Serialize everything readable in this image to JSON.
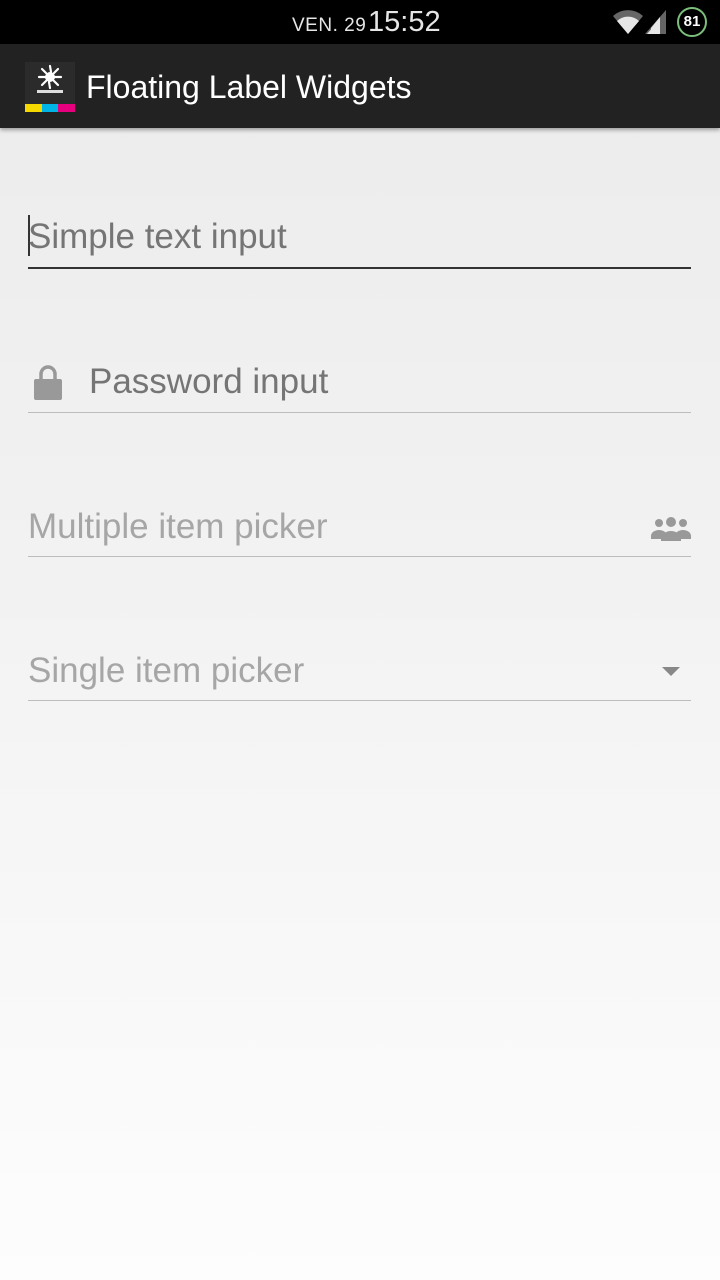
{
  "status_bar": {
    "date": "VEN. 29",
    "time": "15:52",
    "battery": "81",
    "icons": [
      "wifi-icon",
      "signal-icon",
      "battery-icon"
    ]
  },
  "action_bar": {
    "title": "Floating Label Widgets",
    "logo_icon": "app-logo-icon"
  },
  "form": {
    "simple_text": {
      "placeholder": "Simple text input",
      "value": ""
    },
    "password": {
      "placeholder": "Password input",
      "value": "",
      "icon": "lock-icon"
    },
    "multi_picker": {
      "placeholder": "Multiple item picker",
      "icon": "people-icon"
    },
    "single_picker": {
      "placeholder": "Single item picker",
      "icon": "dropdown-arrow-icon"
    }
  },
  "colors": {
    "status_bar": "#000000",
    "action_bar": "#222222",
    "hint_text": "#a6a6a6",
    "underline": "#bdbdbd",
    "focused_underline": "#333333",
    "battery_ring": "#7cbf7c",
    "logo_stripes": [
      "#f5d800",
      "#00b4e6",
      "#e6007e"
    ]
  }
}
